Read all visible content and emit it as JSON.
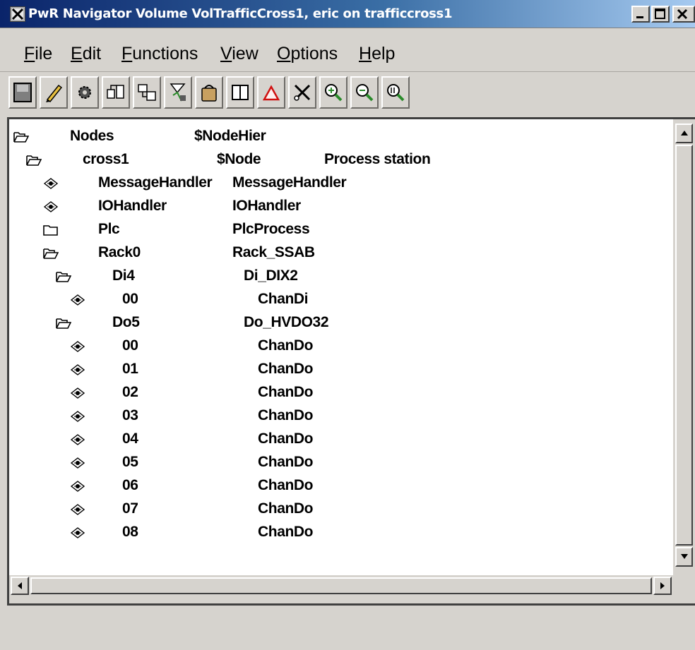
{
  "window": {
    "title": "PwR Navigator Volume VolTrafficCross1, eric on trafficcross1",
    "controls": [
      "minimize",
      "maximize",
      "close"
    ]
  },
  "menu": {
    "items": [
      {
        "mnemonic": "F",
        "rest": "ile"
      },
      {
        "mnemonic": "E",
        "rest": "dit"
      },
      {
        "mnemonic": "F",
        "rest": "unctions"
      },
      {
        "mnemonic": "V",
        "rest": "iew"
      },
      {
        "mnemonic": "O",
        "rest": "ptions"
      },
      {
        "mnemonic": "H",
        "rest": "elp"
      }
    ]
  },
  "toolbar": {
    "buttons": [
      {
        "icon": "save-icon"
      },
      {
        "icon": "pencil-edit-icon"
      },
      {
        "icon": "gear-icon"
      },
      {
        "icon": "object-hierarchy-icon"
      },
      {
        "icon": "object-graph-icon"
      },
      {
        "icon": "crossreference-icon"
      },
      {
        "icon": "bucket-icon"
      },
      {
        "icon": "split-window-icon"
      },
      {
        "icon": "warning-triangle-icon"
      },
      {
        "icon": "scissors-tools-icon"
      },
      {
        "icon": "zoom-in-icon"
      },
      {
        "icon": "zoom-out-icon"
      },
      {
        "icon": "zoom-reset-icon"
      }
    ]
  },
  "tree": {
    "rows": [
      {
        "icon": "folder-open",
        "name": "Nodes",
        "class": "$NodeHier",
        "desc": ""
      },
      {
        "icon": "folder-open",
        "name": "cross1",
        "class": "$Node",
        "desc": "Process station"
      },
      {
        "icon": "leaf",
        "name": "MessageHandler",
        "class": "MessageHandler",
        "desc": ""
      },
      {
        "icon": "leaf",
        "name": "IOHandler",
        "class": "IOHandler",
        "desc": ""
      },
      {
        "icon": "folder-closed",
        "name": "Plc",
        "class": "PlcProcess",
        "desc": ""
      },
      {
        "icon": "folder-open",
        "name": "Rack0",
        "class": "Rack_SSAB",
        "desc": ""
      },
      {
        "icon": "folder-open",
        "name": "Di4",
        "class": "Di_DIX2",
        "desc": ""
      },
      {
        "icon": "leaf",
        "name": "00",
        "class": "ChanDi",
        "desc": ""
      },
      {
        "icon": "folder-open",
        "name": "Do5",
        "class": "Do_HVDO32",
        "desc": ""
      },
      {
        "icon": "leaf",
        "name": "00",
        "class": "ChanDo",
        "desc": ""
      },
      {
        "icon": "leaf",
        "name": "01",
        "class": "ChanDo",
        "desc": ""
      },
      {
        "icon": "leaf",
        "name": "02",
        "class": "ChanDo",
        "desc": ""
      },
      {
        "icon": "leaf",
        "name": "03",
        "class": "ChanDo",
        "desc": ""
      },
      {
        "icon": "leaf",
        "name": "04",
        "class": "ChanDo",
        "desc": ""
      },
      {
        "icon": "leaf",
        "name": "05",
        "class": "ChanDo",
        "desc": ""
      },
      {
        "icon": "leaf",
        "name": "06",
        "class": "ChanDo",
        "desc": ""
      },
      {
        "icon": "leaf",
        "name": "07",
        "class": "ChanDo",
        "desc": ""
      },
      {
        "icon": "leaf",
        "name": "08",
        "class": "ChanDo",
        "desc": ""
      }
    ]
  }
}
